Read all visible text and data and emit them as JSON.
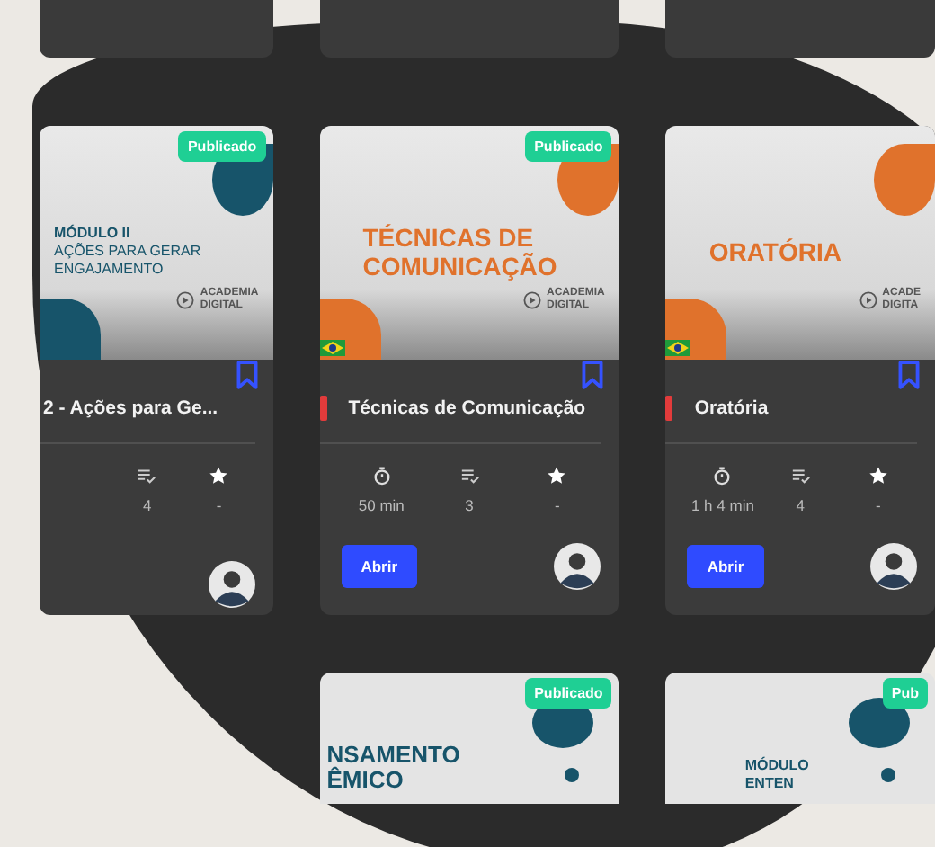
{
  "cards": [
    {
      "color": "#17546a",
      "badge": "Publicado",
      "cover_lines": [
        "MÓDULO II",
        "AÇÕES PARA GERAR",
        "ENGAJAMENTO"
      ],
      "logo": [
        "ACADEMIA",
        "DIGITAL"
      ],
      "flag": false,
      "marker": false,
      "title": "2 - Ações para Ge...",
      "stats": [
        {
          "kind": "lessons",
          "value": "4"
        },
        {
          "kind": "rating",
          "value": "-"
        }
      ]
    },
    {
      "color": "#e0722c",
      "badge": "Publicado",
      "cover_lines": [
        "TÉCNICAS DE",
        "COMUNICAÇÃO"
      ],
      "logo": [
        "ACADEMIA",
        "DIGITAL"
      ],
      "flag": true,
      "marker": true,
      "title": "Técnicas de Comunicação",
      "stats": [
        {
          "kind": "duration",
          "value": "50 min"
        },
        {
          "kind": "lessons",
          "value": "3"
        },
        {
          "kind": "rating",
          "value": "-"
        }
      ],
      "button": "Abrir"
    },
    {
      "color": "#e0722c",
      "cover_lines": [
        "ORATÓRIA"
      ],
      "logo": [
        "ACADE",
        "DIGITA"
      ],
      "flag": true,
      "marker": true,
      "title": "Oratória",
      "stats": [
        {
          "kind": "duration",
          "value": "1 h 4 min"
        },
        {
          "kind": "lessons",
          "value": "4"
        },
        {
          "kind": "rating",
          "value": "-"
        }
      ],
      "button": "Abrir"
    }
  ],
  "next_row": [
    {
      "color": "#17546a",
      "badge": "Publicado",
      "cover_lines": [
        "NSAMENTO",
        "ÊMICO"
      ]
    },
    {
      "color": "#17546a",
      "badge": "Pub",
      "cover_lines": [
        "MÓDULO",
        "ENTEN"
      ]
    }
  ]
}
